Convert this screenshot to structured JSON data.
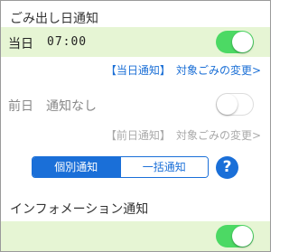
{
  "garbage_day": {
    "title": "ごみ出し日通知",
    "same_day": {
      "label": "当日",
      "time": "07:00",
      "enabled": true,
      "link_notify": "【当日通知】",
      "link_change": "対象ごみの変更>"
    },
    "prev_day": {
      "label": "前日",
      "status": "通知なし",
      "enabled": false,
      "link_notify": "【前日通知】",
      "link_change": "対象ごみの変更>"
    }
  },
  "mode_segment": {
    "options": [
      "個別通知",
      "一括通知"
    ],
    "selected": "個別通知"
  },
  "help_button": {
    "label": "?"
  },
  "info": {
    "title": "インフォメーション通知",
    "enabled": true
  },
  "colors": {
    "toggle_on": "#4cd964",
    "row_highlight": "#e6f5d4",
    "accent": "#1a6fd8"
  }
}
